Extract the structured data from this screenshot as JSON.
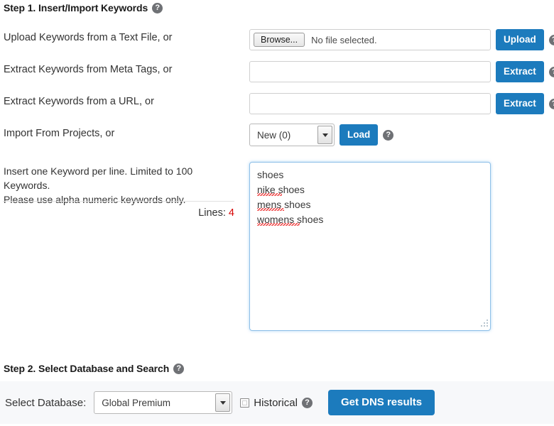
{
  "step1": {
    "heading": "Step 1. Insert/Import Keywords",
    "help_icon": "help-circle-icon",
    "rows": [
      {
        "label": "Upload Keywords from a Text File, or",
        "browse_label": "Browse...",
        "file_status": "No file selected.",
        "action_label": "Upload"
      },
      {
        "label": "Extract Keywords from Meta Tags, or",
        "input_value": "",
        "input_placeholder": "",
        "action_label": "Extract"
      },
      {
        "label": "Extract Keywords from a URL, or",
        "input_value": "",
        "input_placeholder": "",
        "action_label": "Extract"
      },
      {
        "label": "Import From Projects, or",
        "select_value": "New (0)",
        "action_label": "Load"
      }
    ],
    "keywords": {
      "instructions_line1": "Insert one Keyword per line. Limited to 100 Keywords.",
      "instructions_line2": "Please use alpha numeric keywords only.",
      "lines_label": "Lines:",
      "lines_count": "4",
      "textarea_value": "shoes\nnike shoes\nmens shoes\nwomens shoes",
      "textarea_placeholder": ""
    }
  },
  "step2": {
    "heading": "Step 2. Select Database and Search",
    "help_icon": "help-circle-icon",
    "database_label": "Select Database:",
    "database_value": "Global Premium",
    "historical_label": "Historical",
    "historical_checked": false,
    "submit_label": "Get DNS results"
  },
  "colors": {
    "accent_blue": "#1c7bbd",
    "lines_count_red": "#d60000",
    "panel_grey": "#f7f8fa",
    "focus_blue": "#8fc0e8"
  }
}
